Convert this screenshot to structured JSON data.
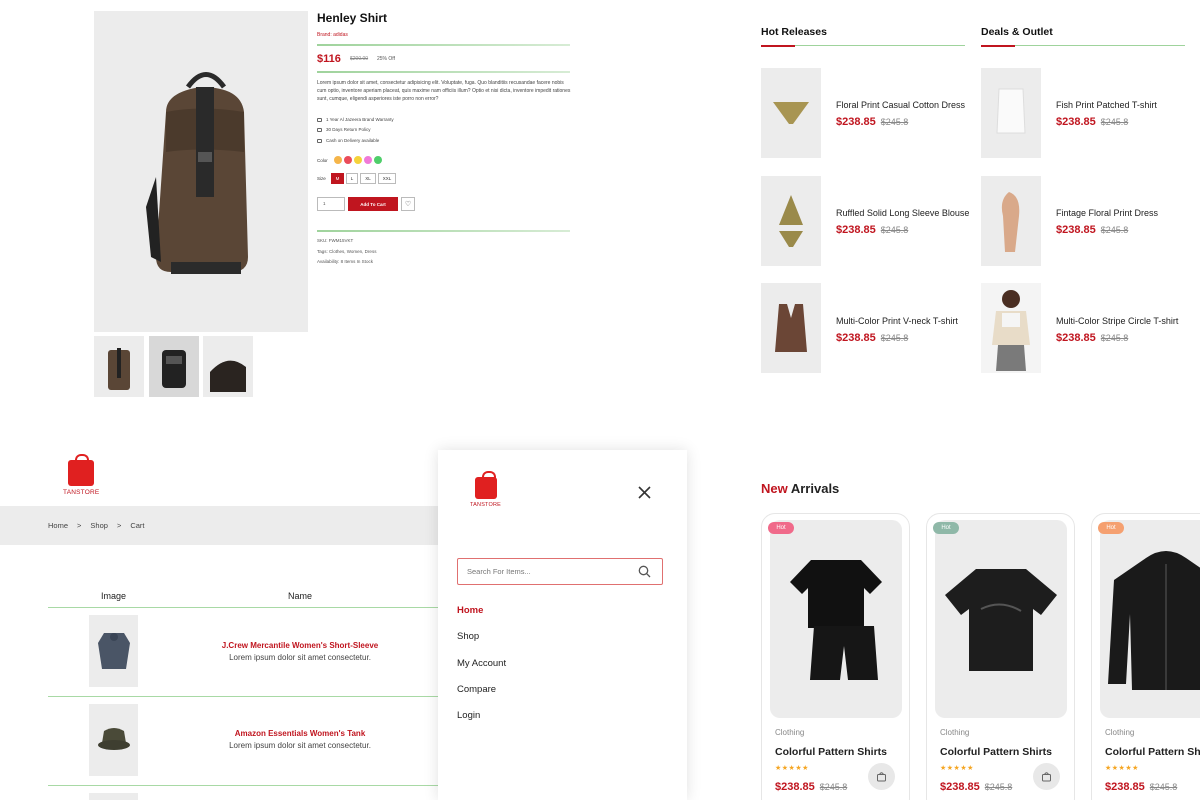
{
  "product": {
    "title": "Henley Shirt",
    "brand": "Brand: adidas",
    "price": "$116",
    "old_price": "$200.00",
    "discount": "25% Off",
    "description": "Lorem ipsum dolor sit amet, consectetur adipisicing elit. Voluptate, fuga. Quo blanditiis recusandae facere nobis cum optio, inventore aperiam placeat, quis maxime nam officiis illum? Optio et nisi dicta, inventore impedit rationes sunt, cumque, eligendi asperiores iste porro non error?",
    "features": [
      "1 Year Al Jazeera Brand Warranty",
      "30 Days Return Policy",
      "Cash on Delivery available"
    ],
    "color_label": "Color",
    "colors": [
      "#f5b54a",
      "#ea4c5a",
      "#f5d23a",
      "#f07ad8",
      "#4fce6a"
    ],
    "size_label": "Size",
    "sizes": [
      "M",
      "L",
      "XL",
      "XXL"
    ],
    "selected_size": "M",
    "quantity": "1",
    "add_to_cart": "Add To Cart",
    "sku": "SKU: FWM15VKT",
    "tags": "Tags: Clothes, Women, Dress",
    "availability": "Availability: 8 Items In Stock"
  },
  "hot_releases": {
    "title": "Hot Releases",
    "items": [
      {
        "name": "Floral Print Casual Cotton Dress",
        "price": "$238.85",
        "old": "$245.8"
      },
      {
        "name": "Ruffled Solid Long Sleeve Blouse",
        "price": "$238.85",
        "old": "$245.8"
      },
      {
        "name": "Multi-Color Print V-neck T-shirt",
        "price": "$238.85",
        "old": "$245.8"
      }
    ]
  },
  "deals": {
    "title": "Deals & Outlet",
    "items": [
      {
        "name": "Fish Print Patched T-shirt",
        "price": "$238.85",
        "old": "$245.8"
      },
      {
        "name": "Fintage Floral Print Dress",
        "price": "$238.85",
        "old": "$245.8"
      },
      {
        "name": "Multi-Color Stripe Circle T-shirt",
        "price": "$238.85",
        "old": "$245.8"
      }
    ]
  },
  "logo_text": "TANSTORE",
  "breadcrumb": [
    "Home",
    ">",
    "Shop",
    ">",
    "Cart"
  ],
  "cart": {
    "headers": [
      "Image",
      "Name"
    ],
    "rows": [
      {
        "name": "J.Crew Mercantile Women's Short-Sleeve",
        "desc": "Lorem ipsum dolor sit amet consectetur."
      },
      {
        "name": "Amazon Essentials Women's Tank",
        "desc": "Lorem ipsum dolor sit amet consectetur."
      }
    ]
  },
  "menu": {
    "search_placeholder": "Search For Items...",
    "items": [
      "Home",
      "Shop",
      "My Account",
      "Compare",
      "Login"
    ],
    "active": "Home"
  },
  "arrivals": {
    "title_new": "New",
    "title_rest": " Arrivals",
    "cards": [
      {
        "badge": "Hot",
        "badge_color": "#f06a8a",
        "category": "Clothing",
        "name": "Colorful Pattern Shirts",
        "price": "$238.85",
        "old": "$245.8"
      },
      {
        "badge": "Hot",
        "badge_color": "#8fb8a8",
        "category": "Clothing",
        "name": "Colorful Pattern Shirts",
        "price": "$238.85",
        "old": "$245.8"
      },
      {
        "badge": "Hot",
        "badge_color": "#f5a070",
        "category": "Clothing",
        "name": "Colorful Pattern Shirts",
        "price": "$238.85",
        "old": "$245.8"
      }
    ]
  },
  "colors": {
    "accent": "#c0151f",
    "line": "#9fd39c"
  }
}
